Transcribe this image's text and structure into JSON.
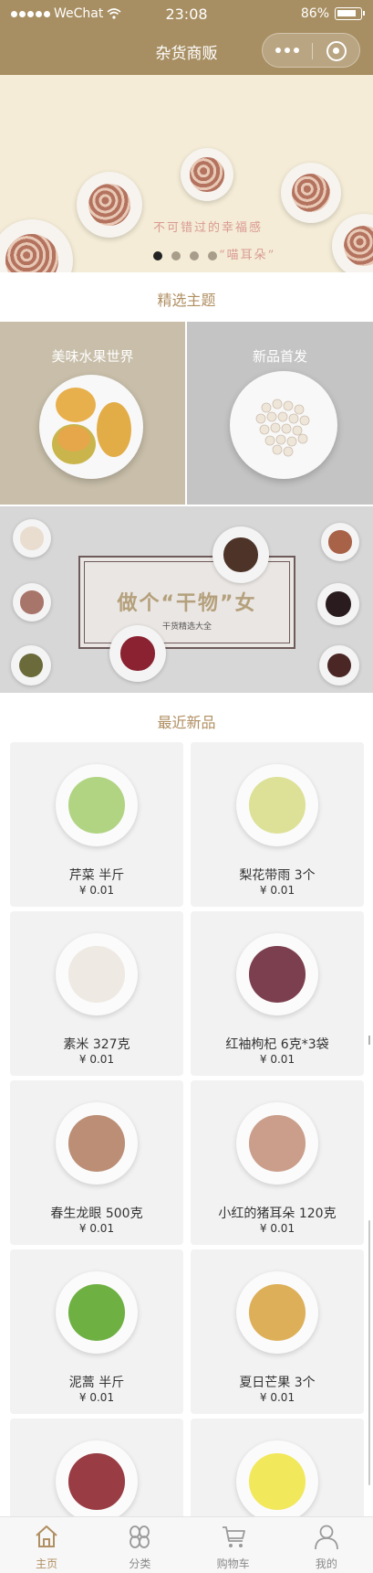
{
  "status_bar": {
    "carrier": "WeChat",
    "time": "23:08",
    "battery": "86%"
  },
  "nav": {
    "title": "杂货商贩"
  },
  "banner": {
    "slogan_line1": "不可错过的幸福感",
    "slogan_line2": "“喵耳朵”",
    "slides_total": 4,
    "active_slide": 1
  },
  "themes": {
    "section_title": "精选主题",
    "items": [
      {
        "label": "美味水果世界",
        "bg": "#c8bea9"
      },
      {
        "label": "新品首发",
        "bg": "#c4c4c4"
      }
    ]
  },
  "promo": {
    "headline": "做个“干物”女",
    "sub": "干货精选大全"
  },
  "recent": {
    "section_title": "最近新品",
    "products": [
      {
        "name": "芹菜 半斤",
        "price": "¥ 0.01",
        "color": "#a9cf76"
      },
      {
        "name": "梨花带雨 3个",
        "price": "¥ 0.01",
        "color": "#d9de8c"
      },
      {
        "name": "素米 327克",
        "price": "¥ 0.01",
        "color": "#ece7df"
      },
      {
        "name": "红袖枸杞 6克*3袋",
        "price": "¥ 0.01",
        "color": "#6e2a3c"
      },
      {
        "name": "春生龙眼 500克",
        "price": "¥ 0.01",
        "color": "#b48266"
      },
      {
        "name": "小红的猪耳朵 120克",
        "price": "¥ 0.01",
        "color": "#c4937d"
      },
      {
        "name": "泥蒿 半斤",
        "price": "¥ 0.01",
        "color": "#5fa72f"
      },
      {
        "name": "夏日芒果 3个",
        "price": "¥ 0.01",
        "color": "#d9a646"
      },
      {
        "name": "",
        "price": "",
        "color": "#8e2730"
      },
      {
        "name": "",
        "price": "",
        "color": "#f1e64a"
      }
    ]
  },
  "tabbar": {
    "tabs": [
      {
        "label": "主页",
        "icon": "home-icon",
        "active": true
      },
      {
        "label": "分类",
        "icon": "category-icon",
        "active": false
      },
      {
        "label": "购物车",
        "icon": "cart-icon",
        "active": false
      },
      {
        "label": "我的",
        "icon": "user-icon",
        "active": false
      }
    ]
  },
  "colors": {
    "brand": "#a88f63",
    "accent_text": "#b08f62"
  }
}
